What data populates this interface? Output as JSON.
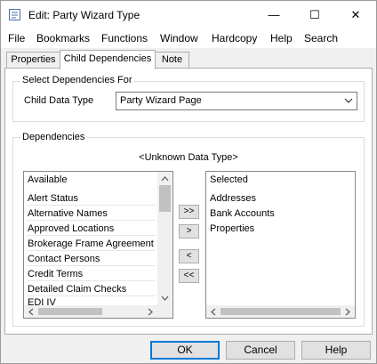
{
  "window": {
    "title": "Edit: Party Wizard Type",
    "minimize_glyph": "—",
    "maximize_glyph": "☐",
    "close_glyph": "✕"
  },
  "menu": [
    "File",
    "Bookmarks",
    "Functions",
    "Window",
    "Hardcopy",
    "Help",
    "Search"
  ],
  "tabs": [
    "Properties",
    "Child Dependencies",
    "Note"
  ],
  "select_group": {
    "label": "Select Dependencies For",
    "field_label": "Child Data Type",
    "value": "Party Wizard Page"
  },
  "dependencies_group": {
    "label": "Dependencies",
    "data_type": "<Unknown Data Type>",
    "available_header": "Available",
    "available_items": [
      "Alert Status",
      "Alternative Names",
      "Approved Locations",
      "Brokerage Frame Agreement",
      "Contact Persons",
      "Credit Terms",
      "Detailed Claim Checks",
      "EDI IV"
    ],
    "selected_header": "Selected",
    "selected_items": [
      "Addresses",
      "Bank Accounts",
      "Properties"
    ]
  },
  "move_buttons": {
    "add_all": ">>",
    "add": ">",
    "remove": "<",
    "remove_all": "<<"
  },
  "buttons": {
    "ok": "OK",
    "cancel": "Cancel",
    "help": "Help"
  }
}
